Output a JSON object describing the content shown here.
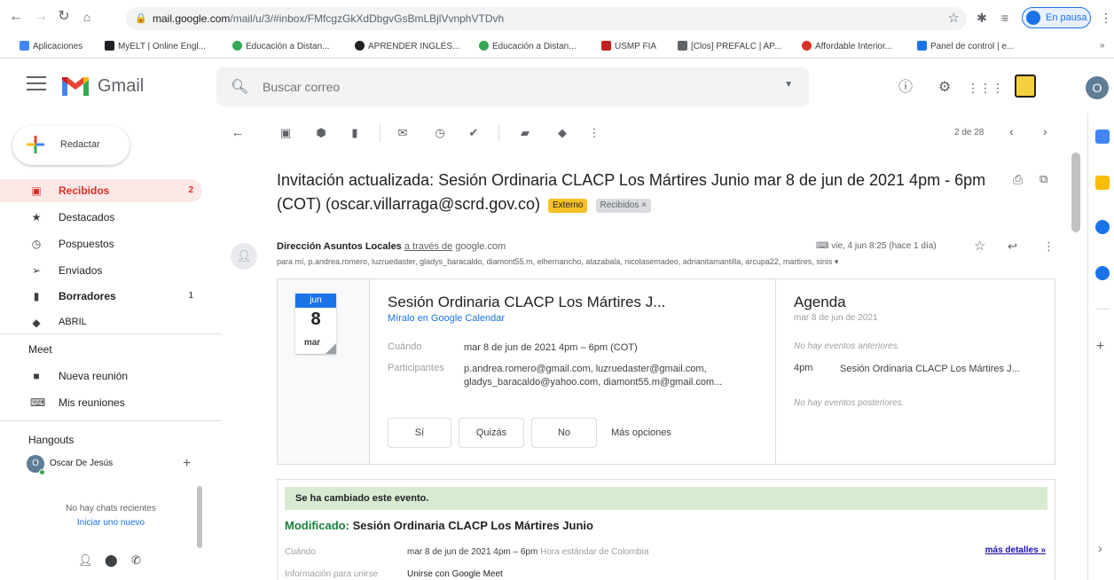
{
  "browser": {
    "url_host": "mail.google.com",
    "url_path": "/mail/u/3/#inbox/FMfcgzGkXdDbgvGsBmLBjlVvnphVTDvh",
    "pause_label": "En pausa"
  },
  "bookmarks": [
    {
      "label": "Aplicaciones",
      "color": "#4285f4"
    },
    {
      "label": "MyELT | Online Engl...",
      "color": "#202124"
    },
    {
      "label": "Educación a Distan...",
      "color": "#34a853"
    },
    {
      "label": "APRENDER INGLÉS...",
      "color": "#202124"
    },
    {
      "label": "Educación a Distan...",
      "color": "#34a853"
    },
    {
      "label": "USMP FIA",
      "color": "#c5221f"
    },
    {
      "label": "[Clos] PREFALC | AP...",
      "color": "#5f6368"
    },
    {
      "label": "Affordable Interior...",
      "color": "#d93025"
    },
    {
      "label": "Panel de control | e...",
      "color": "#1a73e8"
    }
  ],
  "gmail": {
    "app_name": "Gmail",
    "search_placeholder": "Buscar correo",
    "avatar_letter": "O"
  },
  "compose_label": "Redactar",
  "nav": [
    {
      "label": "Recibidos",
      "count": "2",
      "icon": "inbox-icon"
    },
    {
      "label": "Destacados",
      "count": "",
      "icon": "star-icon"
    },
    {
      "label": "Pospuestos",
      "count": "",
      "icon": "clock-icon"
    },
    {
      "label": "Enviados",
      "count": "",
      "icon": "send-icon"
    },
    {
      "label": "Borradores",
      "count": "1",
      "icon": "draft-icon"
    },
    {
      "label": "ABRIL",
      "count": "",
      "icon": "label-icon"
    }
  ],
  "meet": {
    "title": "Meet",
    "new_meeting": "Nueva reunión",
    "my_meetings": "Mis reuniones"
  },
  "hangouts": {
    "title": "Hangouts",
    "user_initial": "O",
    "user_name": "Oscar De Jesús",
    "no_chats": "No hay chats recientes",
    "start_new": "Iniciar uno nuevo"
  },
  "toolbar": {
    "pager": "2 de 28"
  },
  "message": {
    "subject": "Invitación actualizada: Sesión Ordinaria CLACP Los Mártires Junio mar 8 de jun de 2021 4pm - 6pm (COT) (oscar.villarraga@scrd.gov.co)",
    "tag_external": "Externo",
    "tag_inbox": "Recibidos ×",
    "sender_name": "Dirección Asuntos Locales",
    "via_prefix": "a través de",
    "via_domain": "google.com",
    "recipients": "para mí, p.andrea.romero, luzruedaster, gladys_baracaldo, diamont55.m, elhernancho, atazabala, nicolasemadeo, adrianitamantilla, arcupa22, martires, sinis ▾",
    "date": "vie, 4 jun 8:25 (hace 1 día)"
  },
  "calendar": {
    "month": "jun",
    "day": "8",
    "weekday": "mar",
    "event_title": "Sesión Ordinaria CLACP Los Mártires J...",
    "view_link": "Míralo en Google Calendar",
    "when_label": "Cuándo",
    "when_value": "mar 8 de jun de 2021 4pm – 6pm (COT)",
    "participants_label": "Participantes",
    "participants_value": "p.andrea.romero@gmail.com, luzruedaster@gmail.com, gladys_baracaldo@yahoo.com, diamont55.m@gmail.com...",
    "rsvp_yes": "Sí",
    "rsvp_maybe": "Quizás",
    "rsvp_no": "No",
    "rsvp_more": "Más opciones"
  },
  "agenda": {
    "title": "Agenda",
    "date": "mar 8 de jun de 2021",
    "no_prev": "No hay eventos anteriores.",
    "event_time": "4pm",
    "event_name": "Sesión Ordinaria CLACP Los Mártires J...",
    "no_next": "No hay eventos posteriores."
  },
  "changed": {
    "banner": "Se ha cambiado este evento.",
    "modified_prefix": "Modificado:",
    "title": "Sesión Ordinaria CLACP Los Mártires Junio",
    "when_label": "Cuándo",
    "when_value": "mar 8 de jun de 2021 4pm – 6pm",
    "when_tz": "Hora estándar de Colombia",
    "more_details": "más detalles »",
    "join_label": "Información para unirse",
    "join_value": "Unirse con Google Meet"
  },
  "colors": {
    "accent": "#1a73e8",
    "inbox_active": "#d93025",
    "modified_green": "#188038",
    "external_tag": "#f6c026"
  }
}
